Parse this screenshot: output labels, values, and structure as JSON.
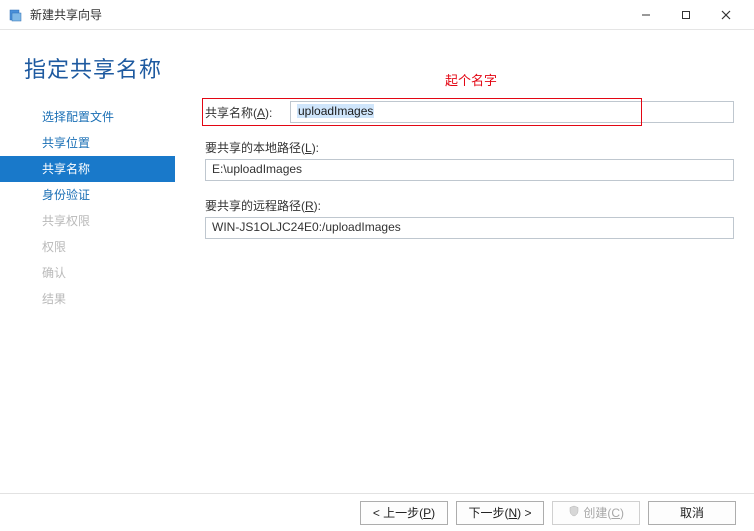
{
  "window": {
    "title": "新建共享向导"
  },
  "page": {
    "title": "指定共享名称"
  },
  "annotation": {
    "text": "起个名字"
  },
  "sidebar": {
    "items": [
      {
        "label": "选择配置文件",
        "state": "enabled"
      },
      {
        "label": "共享位置",
        "state": "enabled"
      },
      {
        "label": "共享名称",
        "state": "active"
      },
      {
        "label": "身份验证",
        "state": "enabled"
      },
      {
        "label": "共享权限",
        "state": "disabled"
      },
      {
        "label": "权限",
        "state": "disabled"
      },
      {
        "label": "确认",
        "state": "disabled"
      },
      {
        "label": "结果",
        "state": "disabled"
      }
    ]
  },
  "form": {
    "share_name_label_pre": "共享名称(",
    "share_name_label_u": "A",
    "share_name_label_post": "):",
    "share_name_value": "uploadImages",
    "local_path_label_pre": "要共享的本地路径(",
    "local_path_label_u": "L",
    "local_path_label_post": "):",
    "local_path_value": "E:\\uploadImages",
    "remote_path_label_pre": "要共享的远程路径(",
    "remote_path_label_u": "R",
    "remote_path_label_post": "):",
    "remote_path_value": "WIN-JS1OLJC24E0:/uploadImages"
  },
  "buttons": {
    "prev_pre": "< 上一步(",
    "prev_u": "P",
    "prev_post": ")",
    "next_pre": "下一步(",
    "next_u": "N",
    "next_post": ") >",
    "create_pre": "创建(",
    "create_u": "C",
    "create_post": ")",
    "cancel": "取消"
  }
}
